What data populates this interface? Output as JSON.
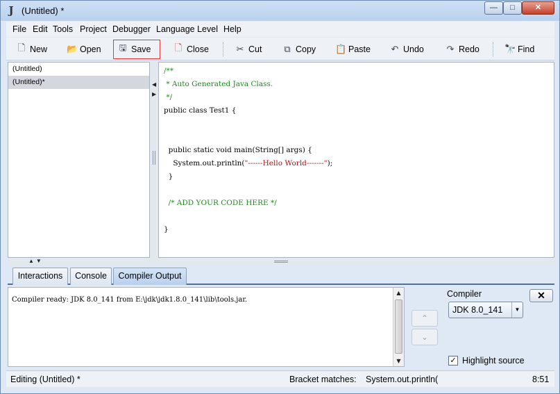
{
  "window": {
    "title": "(Untitled) *",
    "app_icon": "J",
    "controls": {
      "minimize": "—",
      "maximize": "□",
      "close": "✕"
    }
  },
  "menu": [
    "File",
    "Edit",
    "Tools",
    "Project",
    "Debugger",
    "Language Level",
    "Help"
  ],
  "toolbar": {
    "new": {
      "label": "New",
      "icon": "🗋"
    },
    "open": {
      "label": "Open",
      "icon": "📂"
    },
    "save": {
      "label": "Save",
      "icon": "🖫"
    },
    "close": {
      "label": "Close",
      "icon": "🗋"
    },
    "cut": {
      "label": "Cut",
      "icon": "✂"
    },
    "copy": {
      "label": "Copy",
      "icon": "⧉"
    },
    "paste": {
      "label": "Paste",
      "icon": "📋"
    },
    "undo": {
      "label": "Undo",
      "icon": "↶"
    },
    "redo": {
      "label": "Redo",
      "icon": "↷"
    },
    "find": {
      "label": "Find",
      "icon": "🔭"
    },
    "active_button": "save",
    "highlight_color": "#e03a3a"
  },
  "documents": [
    {
      "name": "(Untitled)",
      "selected": false
    },
    {
      "name": "(Untitled)*",
      "selected": true
    }
  ],
  "editor": {
    "lines": [
      {
        "text": "/**",
        "style": "comment"
      },
      {
        "text": " * Auto Generated Java Class.",
        "style": "comment"
      },
      {
        "text": " */",
        "style": "comment"
      },
      {
        "text": "public class Test1 {",
        "style": "plain"
      },
      {
        "text": "",
        "style": "plain"
      },
      {
        "text": "",
        "style": "plain"
      },
      {
        "text": "  public static void main(String[] args) {",
        "style": "plain"
      },
      {
        "text_pre": "    System.out.println(",
        "string": "\"------Hello World-------\"",
        "text_post": ");",
        "style": "mixed"
      },
      {
        "text": "  }",
        "style": "plain"
      },
      {
        "text": "",
        "style": "plain"
      },
      {
        "text": "  /* ADD YOUR CODE HERE */",
        "style": "comment"
      },
      {
        "text": "",
        "style": "plain"
      },
      {
        "text": "}",
        "style": "plain"
      }
    ],
    "colors": {
      "comment": "#1f8a1f",
      "plain": "#000000",
      "string": "#b0111b"
    }
  },
  "tabs": [
    {
      "label": "Interactions",
      "active": false
    },
    {
      "label": "Console",
      "active": false
    },
    {
      "label": "Compiler Output",
      "active": true
    }
  ],
  "output": {
    "text": "Compiler ready: JDK 8.0_141 from E:\\jdk\\jdk1.8.0_141\\lib\\tools.jar."
  },
  "compiler": {
    "label": "Compiler",
    "selected": "JDK 8.0_141",
    "close_label": "✕",
    "up_icon": "⌃",
    "down_icon": "⌄"
  },
  "highlight_source": {
    "label": "Highlight source",
    "checked": true,
    "mark": "✓"
  },
  "status": {
    "editing": "Editing (Untitled) *",
    "bracket_label": "Bracket matches:",
    "bracket_value": "System.out.println(",
    "position": "8:51"
  }
}
